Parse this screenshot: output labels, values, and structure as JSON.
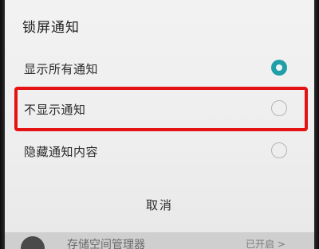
{
  "dialog": {
    "title": "锁屏通知",
    "options": [
      {
        "label": "显示所有通知",
        "selected": true
      },
      {
        "label": "不显示通知",
        "selected": false,
        "highlighted": true
      },
      {
        "label": "隐藏通知内容",
        "selected": false
      }
    ],
    "cancel_label": "取消"
  },
  "background": {
    "partial_text": "存储空间管理器",
    "partial_right_text": "已开启 >"
  },
  "colors": {
    "accent": "#1f9fa8",
    "highlight": "#e41212"
  }
}
